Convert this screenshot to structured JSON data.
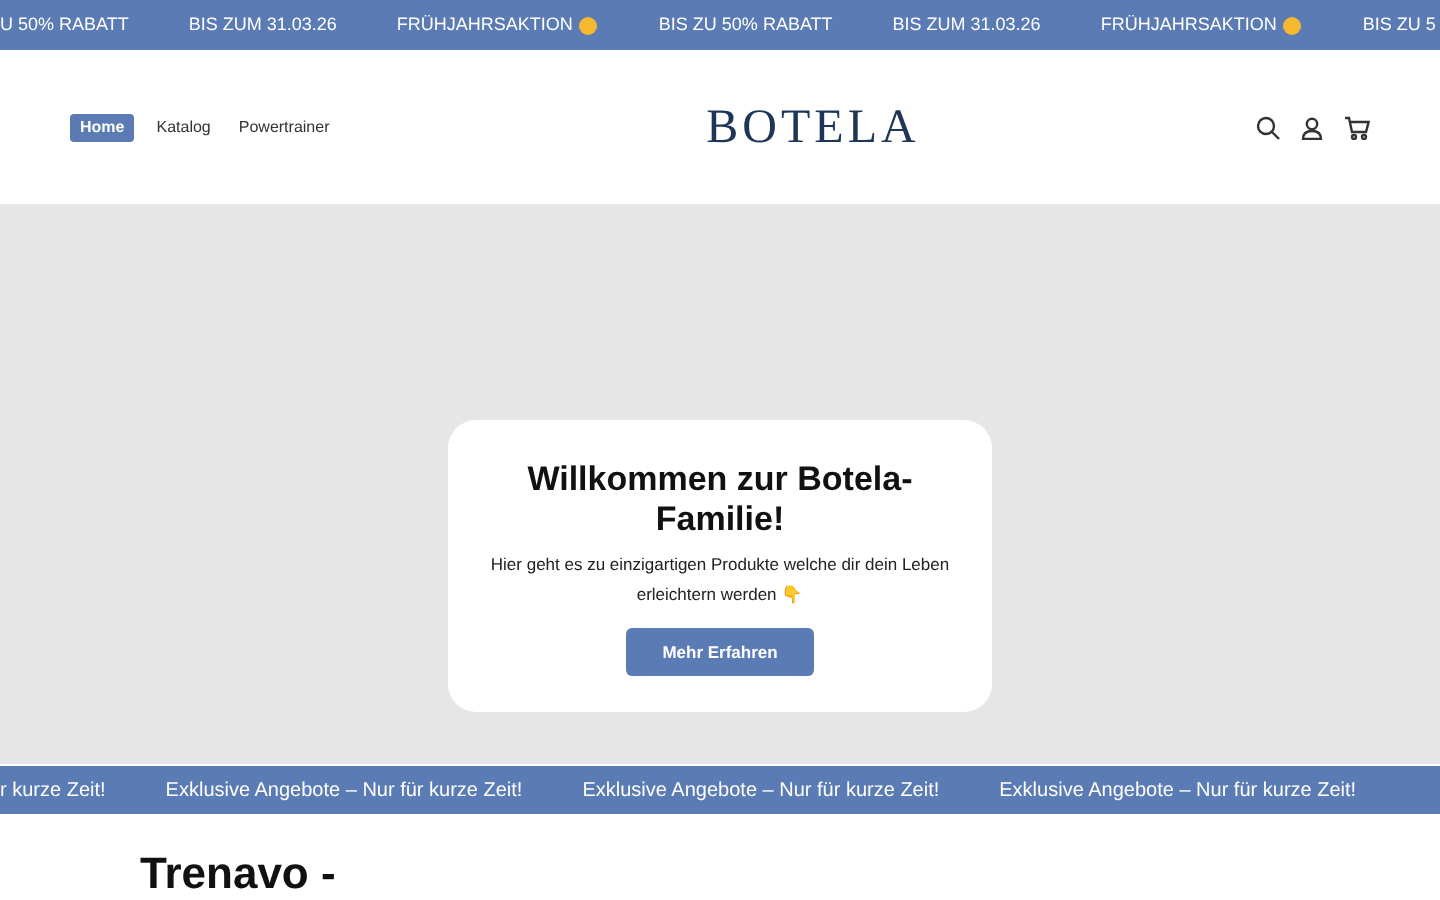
{
  "announcement_bar": [
    {
      "text": "U 50% RABATT",
      "sun": false
    },
    {
      "text": "BIS ZUM 31.03.26",
      "sun": false
    },
    {
      "text": "FRÜHJAHRSAKTION",
      "sun": true
    },
    {
      "text": "BIS ZU 50% RABATT",
      "sun": false
    },
    {
      "text": "BIS ZUM 31.03.26",
      "sun": false
    },
    {
      "text": "FRÜHJAHRSAKTION",
      "sun": true
    },
    {
      "text": "BIS ZU 5",
      "sun": false
    }
  ],
  "nav": [
    {
      "label": "Home",
      "selected": true
    },
    {
      "label": "Katalog",
      "selected": false
    },
    {
      "label": "Powertrainer",
      "selected": false
    }
  ],
  "logo": "BOTELA",
  "hero": {
    "title": "Willkommen zur Botela-Familie!",
    "text": "Hier geht es zu einzigartigen Produkte welche dir dein Leben erleichtern werden 👇",
    "button": "Mehr Erfahren"
  },
  "ticker": [
    "r kurze Zeit!",
    "Exklusive Angebote – Nur für kurze Zeit!",
    "Exklusive Angebote – Nur für kurze Zeit!",
    "Exklusive Angebote – Nur für kurze Zeit!"
  ],
  "section_title": "Trenavo -"
}
